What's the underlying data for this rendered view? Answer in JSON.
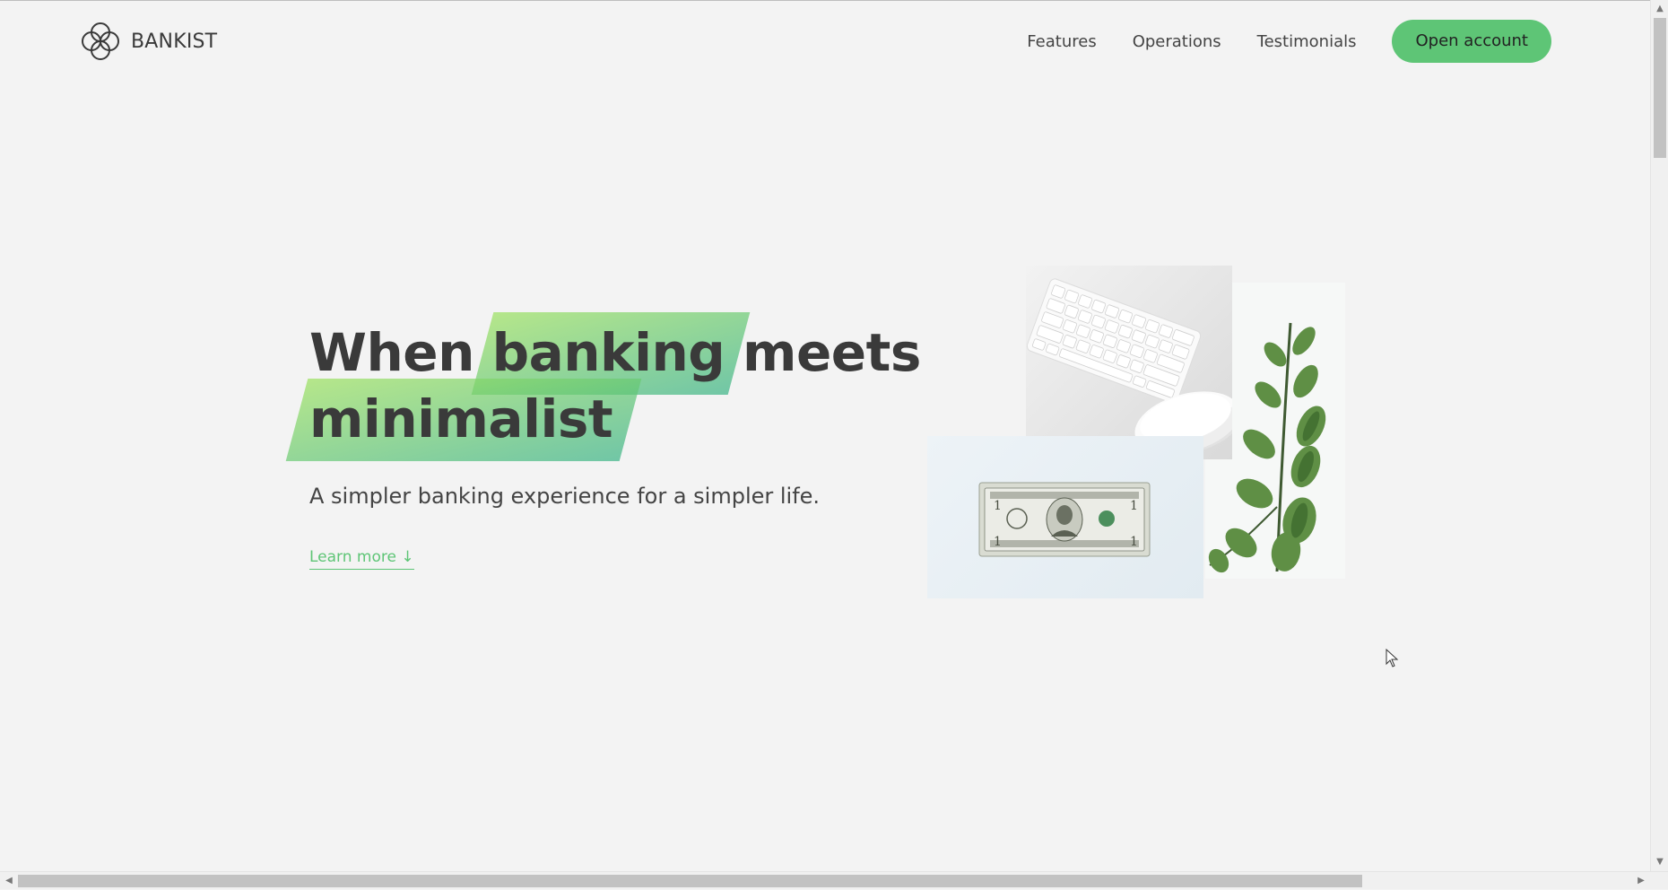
{
  "nav": {
    "logo_text": "BANKIST",
    "links": [
      "Features",
      "Operations",
      "Testimonials"
    ],
    "cta": "Open account"
  },
  "hero": {
    "title_part1": "When",
    "title_highlight1": "banking",
    "title_part2": "meets",
    "title_highlight2": "minimalist",
    "subtitle": "A simpler banking experience for a simpler life.",
    "learn_more": "Learn more ↓"
  },
  "colors": {
    "accent": "#5ec576",
    "background": "#f3f3f3",
    "text": "#444444"
  }
}
